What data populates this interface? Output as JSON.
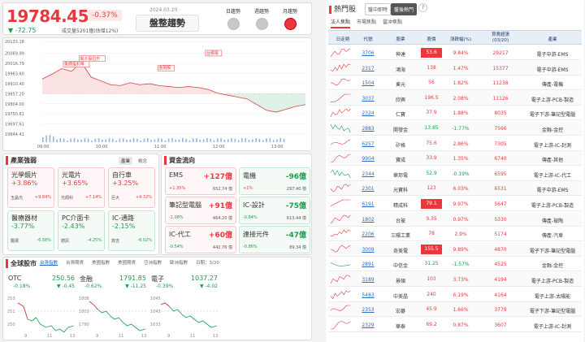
{
  "index": {
    "value": "19784.45",
    "pct": "-0.37%",
    "change": "▼ -72.75",
    "volume": "成交量5201億(估增12%)",
    "date": "2024.03.20",
    "trend": "盤整趨勢"
  },
  "trend_options": [
    {
      "label": "日趨勢",
      "active": false
    },
    {
      "label": "週趨勢",
      "active": false
    },
    {
      "label": "月趨勢",
      "active": true
    }
  ],
  "chart_data": {
    "type": "line",
    "y_ticks": [
      "20133.18",
      "20069.99",
      "20016.79",
      "19963.60",
      "19910.40",
      "19857.20",
      "19804.00",
      "19750.81",
      "19697.61",
      "19644.41"
    ],
    "x_ticks": [
      "09:00",
      "10:00",
      "11:00",
      "12:00",
      "13:00"
    ],
    "prev_close": 19857.2,
    "ylim": [
      19644.41,
      20133.18
    ],
    "annotations": [
      "美債殖利率",
      "電子股拉升",
      "金融股",
      "台積電",
      "外資買超"
    ],
    "x": [
      "09:00",
      "09:10",
      "09:20",
      "09:30",
      "09:40",
      "09:50",
      "10:00",
      "10:10",
      "10:20",
      "10:30",
      "10:40",
      "10:50",
      "11:00",
      "11:10",
      "11:20",
      "11:30",
      "11:40",
      "11:50",
      "12:00",
      "12:10",
      "12:20",
      "12:30",
      "12:40",
      "12:50",
      "13:00",
      "13:10",
      "13:20",
      "13:30"
    ],
    "values": [
      19935,
      19960,
      19990,
      19975,
      20025,
      19945,
      19925,
      19905,
      19900,
      19915,
      19905,
      19910,
      19900,
      19895,
      19890,
      19895,
      19890,
      19880,
      19860,
      19850,
      19840,
      19830,
      19800,
      19770,
      19760,
      19775,
      19790,
      19800
    ]
  },
  "industry": {
    "title": "產業強弱",
    "tabs": [
      "產業",
      "概念"
    ],
    "tiles": [
      {
        "name": "光學鏡片",
        "pct": "+3.86%",
        "leader": "玉晶光",
        "leader_pct": "+9.84%",
        "dir": "up"
      },
      {
        "name": "光電片",
        "pct": "+3.65%",
        "leader": "光頡科",
        "leader_pct": "+7.14%",
        "dir": "up"
      },
      {
        "name": "自行車",
        "pct": "+3.25%",
        "leader": "巨大",
        "leader_pct": "+4.32%",
        "dir": "up"
      },
      {
        "name": "醫療器材",
        "pct": "-3.77%",
        "leader": "醫揚",
        "leader_pct": "-6.58%",
        "dir": "dn"
      },
      {
        "name": "PC介面卡",
        "pct": "-2.43%",
        "leader": "撼訊",
        "leader_pct": "-4.25%",
        "dir": "dn"
      },
      {
        "name": "IC-通路",
        "pct": "-2.15%",
        "leader": "敦吉",
        "leader_pct": "-6.02%",
        "dir": "dn"
      }
    ]
  },
  "flow": {
    "title": "資金流向",
    "tiles": [
      {
        "name": "EMS",
        "value": "+127億",
        "pct": "+1.35%",
        "amount": "652.74 億",
        "dir": "up"
      },
      {
        "name": "電機",
        "value": "-96億",
        "pct": "+1%",
        "amount": "297.40 億",
        "dir": "dn"
      },
      {
        "name": "筆記型電腦",
        "value": "+91億",
        "pct": "-1.08%",
        "amount": "464.20 億",
        "dir": "up"
      },
      {
        "name": "IC-設計",
        "value": "-75億",
        "pct": "-0.84%",
        "amount": "613.44 億",
        "dir": "dn"
      },
      {
        "name": "IC-代工",
        "value": "+60億",
        "pct": "-0.54%",
        "amount": "442.76 億",
        "dir": "up"
      },
      {
        "name": "連接元件",
        "value": "-47億",
        "pct": "-0.86%",
        "amount": "89.34 億",
        "dir": "dn"
      }
    ]
  },
  "global": {
    "title": "全球股市",
    "tabs": [
      "台灣指數",
      "台灣期貨",
      "美國指數",
      "美國期貨",
      "亞洲指數",
      "歐洲指數",
      "日期：3/20"
    ],
    "minis": [
      {
        "name": "OTC",
        "value": "250.56",
        "pct": "-0.18%",
        "change": "▼ -0.45",
        "y_labels": [
          "253",
          "251",
          "250"
        ],
        "x_labels": [
          "9",
          "11",
          "13"
        ]
      },
      {
        "name": "金融",
        "value": "1791.85",
        "pct": "-0.62%",
        "change": "▼ -11.25",
        "y_labels": [
          "1808",
          "1803",
          "1790"
        ],
        "x_labels": [
          "9",
          "11",
          "13"
        ]
      },
      {
        "name": "電子",
        "value": "1037.27",
        "pct": "-0.39%",
        "change": "▼ -4.02",
        "y_labels": [
          "1045",
          "1043",
          "1033"
        ],
        "x_labels": [
          "9",
          "11",
          "13"
        ]
      }
    ]
  },
  "hot": {
    "title": "熱門股",
    "tabs": [
      "盤中即時",
      "盤後熱門"
    ],
    "help": "?",
    "subtabs": [
      "法人焦點",
      "市場焦點",
      "當沖焦點"
    ],
    "headers": [
      "日走勢",
      "代號",
      "股票",
      "股價",
      "漲跌幅(%)",
      "買賣超張\n(03/20)",
      "產業"
    ],
    "rows": [
      {
        "code": "3706",
        "name": "神達",
        "price": "53.6",
        "pct": "9.84%",
        "net": "29217",
        "ind": "電子中游-EMS",
        "flash": true,
        "dir": "up"
      },
      {
        "code": "2317",
        "name": "鴻海",
        "price": "138",
        "pct": "1.47%",
        "net": "15377",
        "ind": "電子中游-EMS",
        "flash": false,
        "dir": "up"
      },
      {
        "code": "1504",
        "name": "東元",
        "price": "56",
        "pct": "1.82%",
        "net": "11238",
        "ind": "傳產-電機",
        "flash": false,
        "dir": "up"
      },
      {
        "code": "3037",
        "name": "欣興",
        "price": "196.5",
        "pct": "2.08%",
        "net": "11126",
        "ind": "電子上游-PCB-製造",
        "flash": false,
        "dir": "up"
      },
      {
        "code": "2324",
        "name": "仁寶",
        "price": "37.9",
        "pct": "1.88%",
        "net": "8035",
        "ind": "電子下游-筆記型電腦",
        "flash": false,
        "dir": "up"
      },
      {
        "code": "2883",
        "name": "開發金",
        "price": "13.85",
        "pct": "-1.77%",
        "net": "7566",
        "ind": "金融-金控",
        "flash": false,
        "dir": "dn"
      },
      {
        "code": "6257",
        "name": "矽格",
        "price": "75.6",
        "pct": "2.86%",
        "net": "7305",
        "ind": "電子上游-IC-封測",
        "flash": false,
        "dir": "up"
      },
      {
        "code": "9904",
        "name": "寶成",
        "price": "33.9",
        "pct": "1.35%",
        "net": "6740",
        "ind": "傳產-其他",
        "flash": false,
        "dir": "up"
      },
      {
        "code": "2344",
        "name": "華邦電",
        "price": "52.9",
        "pct": "-0.19%",
        "net": "6595",
        "ind": "電子上游-IC-代工",
        "flash": false,
        "dir": "dn"
      },
      {
        "code": "2301",
        "name": "光寶科",
        "price": "123",
        "pct": "6.03%",
        "net": "6531",
        "ind": "電子中游-EMS",
        "flash": false,
        "dir": "up"
      },
      {
        "code": "6191",
        "name": "精成科",
        "price": "79.1",
        "pct": "9.97%",
        "net": "5647",
        "ind": "電子上游-PCB-製造",
        "flash": true,
        "dir": "up"
      },
      {
        "code": "1802",
        "name": "台玻",
        "price": "9.35",
        "pct": "0.97%",
        "net": "5330",
        "ind": "傳產-玻陶",
        "flash": false,
        "dir": "up"
      },
      {
        "code": "2206",
        "name": "三陽工業",
        "price": "78",
        "pct": "2.9%",
        "net": "5174",
        "ind": "傳產-汽車",
        "flash": false,
        "dir": "up"
      },
      {
        "code": "3009",
        "name": "奇美電",
        "price": "155.5",
        "pct": "9.89%",
        "net": "4870",
        "ind": "電子下游-筆記型電腦",
        "flash": true,
        "dir": "up"
      },
      {
        "code": "2891",
        "name": "中信金",
        "price": "31.25",
        "pct": "-1.57%",
        "net": "4525",
        "ind": "金融-金控",
        "flash": false,
        "dir": "dn"
      },
      {
        "code": "3189",
        "name": "景碩",
        "price": "103",
        "pct": "3.73%",
        "net": "4194",
        "ind": "電子上游-PCB-製造",
        "flash": false,
        "dir": "up"
      },
      {
        "code": "5483",
        "name": "中美晶",
        "price": "240",
        "pct": "6.19%",
        "net": "4164",
        "ind": "電子上游-太陽能",
        "flash": false,
        "dir": "up"
      },
      {
        "code": "2353",
        "name": "宏碁",
        "price": "45.9",
        "pct": "1.66%",
        "net": "3779",
        "ind": "電子下游-筆記型電腦",
        "flash": false,
        "dir": "up"
      },
      {
        "code": "2329",
        "name": "華泰",
        "price": "69.2",
        "pct": "0.87%",
        "net": "3607",
        "ind": "電子上游-IC-封測",
        "flash": false,
        "dir": "up"
      }
    ]
  }
}
